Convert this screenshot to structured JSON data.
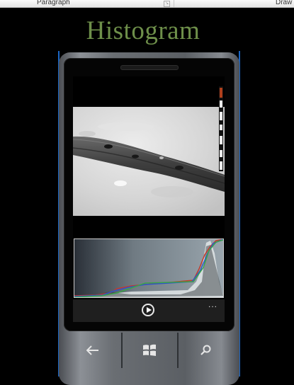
{
  "ribbon": {
    "paragraph_label": "Paragraph",
    "draw_label": "Draw"
  },
  "title": "Histogram",
  "phone": {
    "hardware_buttons": [
      {
        "name": "back-icon"
      },
      {
        "name": "windows-start-icon"
      },
      {
        "name": "search-icon"
      }
    ],
    "app_bar": {
      "play_icon": "play-circle-icon",
      "more_label": "..."
    }
  },
  "colors": {
    "title": "#6e8f4a",
    "accent": "#1b66c4"
  }
}
